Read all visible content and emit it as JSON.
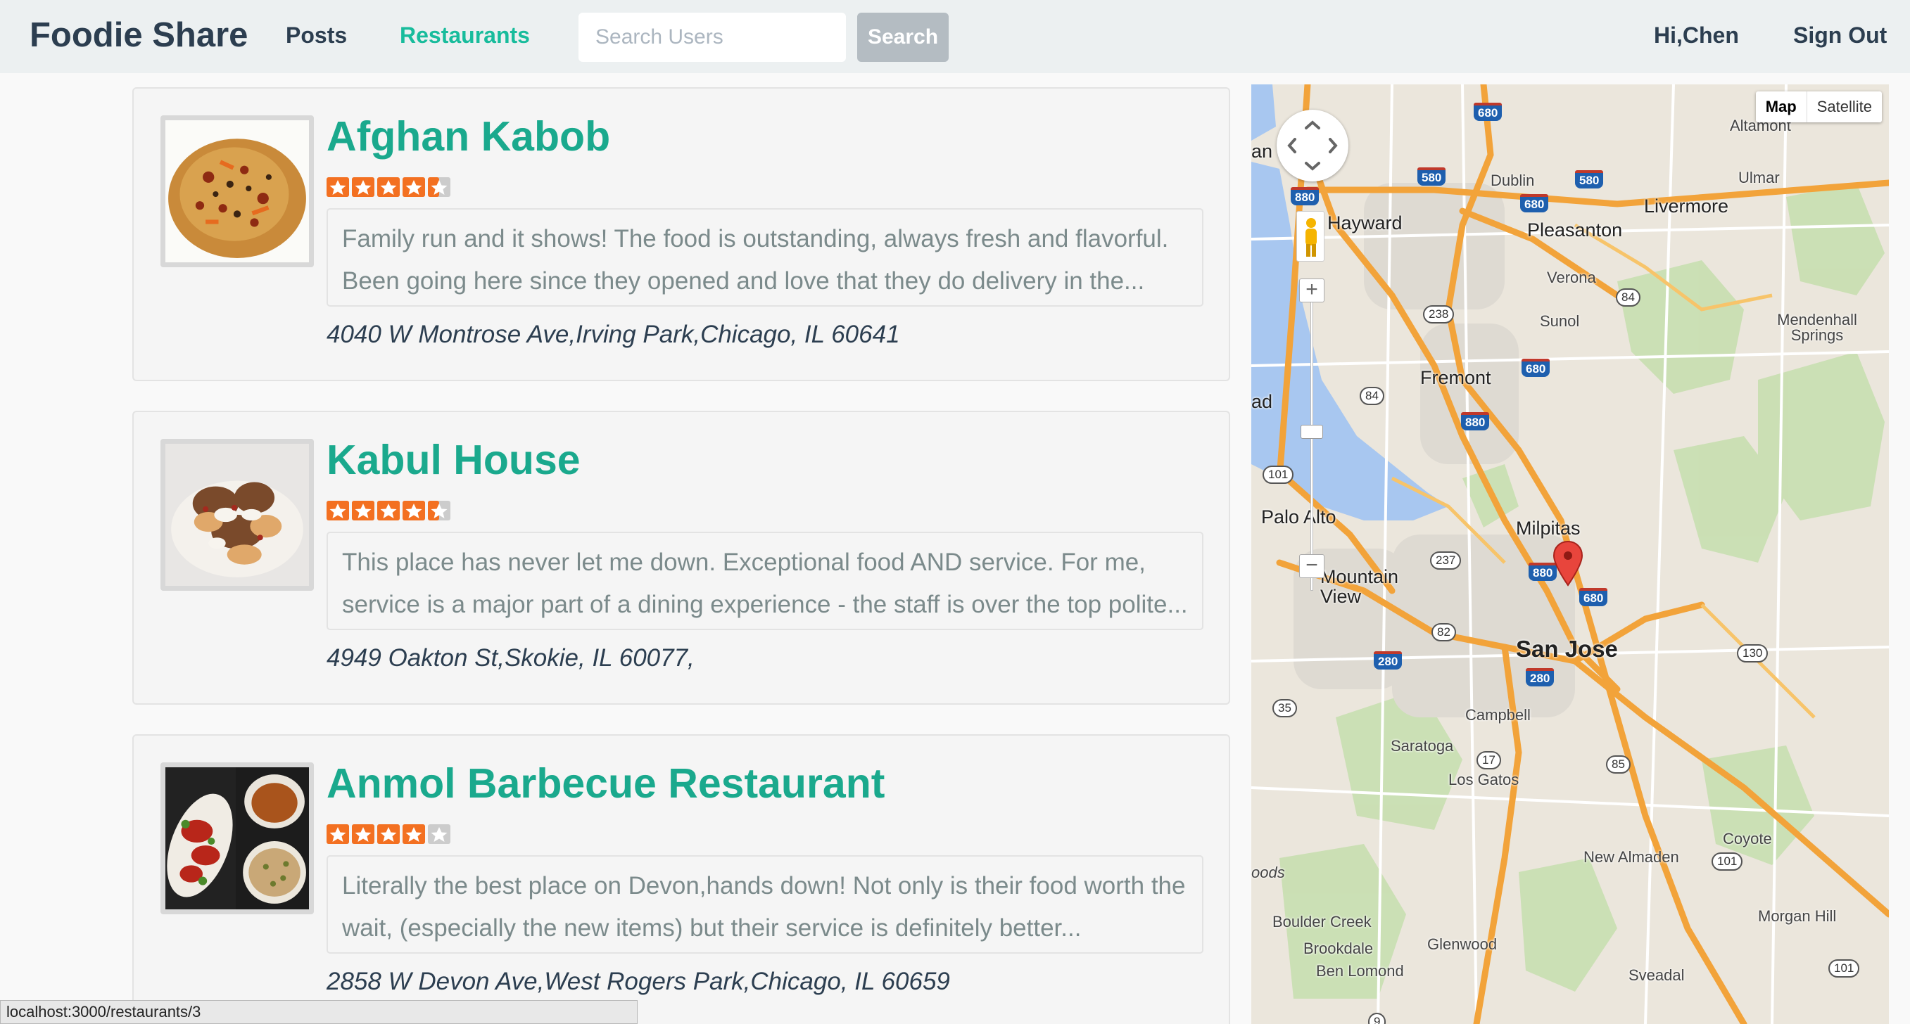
{
  "navbar": {
    "brand": "Foodie Share",
    "links": [
      {
        "label": "Posts",
        "active": false
      },
      {
        "label": "Restaurants",
        "active": true
      }
    ],
    "search": {
      "placeholder": "Search Users",
      "value": "",
      "button_label": "Search"
    },
    "greeting": "Hi,Chen",
    "sign_out_label": "Sign Out"
  },
  "restaurants": [
    {
      "name": "Afghan Kabob",
      "rating": 4.5,
      "max_rating": 5,
      "snippet": "Family run and it shows! The food is outstanding, always fresh and flavorful. Been going here since they opened and love that they do delivery in the...",
      "address": "4040 W Montrose Ave,Irving Park,Chicago, IL 60641"
    },
    {
      "name": "Kabul House",
      "rating": 4.5,
      "max_rating": 5,
      "snippet": "This place has never let me down. Exceptional food AND service. For me, service is a major part of a dining experience - the staff is over the top polite...",
      "address": "4949 Oakton St,Skokie, IL 60077,"
    },
    {
      "name": "Anmol Barbecue Restaurant",
      "rating": 4,
      "max_rating": 5,
      "snippet": "Literally the best place on Devon,hands down! Not only is their food worth the wait, (especially the new items) but their service is definitely better...",
      "address": "2858 W Devon Ave,West Rogers Park,Chicago, IL 60659"
    }
  ],
  "map": {
    "type_buttons": [
      "Map",
      "Satellite"
    ],
    "selected_type": "Map",
    "zoom_in_label": "+",
    "zoom_out_label": "−",
    "places": {
      "san_jose": "San Jose",
      "fremont": "Fremont",
      "milpitas": "Milpitas",
      "hayward": "Hayward",
      "pleasanton": "Pleasanton",
      "livermore": "Livermore",
      "dublin": "Dublin",
      "verona": "Verona",
      "sunol": "Sunol",
      "palo_alto": "Palo Alto",
      "mountain_view": "Mountain View",
      "campbell": "Campbell",
      "saratoga": "Saratoga",
      "los_gatos": "Los Gatos",
      "coyote": "Coyote",
      "new_almaden": "New Almaden",
      "morgan_hill": "Morgan Hill",
      "boulder_creek": "Boulder Creek",
      "brookdale": "Brookdale",
      "ben_lomond": "Ben Lomond",
      "glenwood": "Glenwood",
      "sveadal": "Sveadal",
      "mendenhall_springs": "Mendenhall Springs",
      "ulmar": "Ulmar",
      "altamont": "Altamont",
      "woods_partial": "oods",
      "an_partial": "an L",
      "ad_partial": "ad"
    },
    "highways": {
      "i680_north": "680",
      "i580_west": "580",
      "i580_east": "580",
      "i880_north": "880",
      "i680_dublin": "680",
      "i680_fremont": "680",
      "i880_fremont": "880",
      "i880_milpitas": "880",
      "i680_sj": "680",
      "i280_west": "280",
      "i280_sj": "280"
    },
    "shields": {
      "r238": "238",
      "r84_west": "84",
      "r84_east": "84",
      "r101_north": "101",
      "r237": "237",
      "r82": "82",
      "r130": "130",
      "r35": "35",
      "r17": "17",
      "r85": "85",
      "r101_south": "101",
      "r101_southeast": "101",
      "r9": "9"
    }
  },
  "status_bar": {
    "url": "localhost:3000/restaurants/3"
  },
  "colors": {
    "brand": "#2c3e50",
    "accent": "#18bc9c",
    "star": "#f37021"
  }
}
